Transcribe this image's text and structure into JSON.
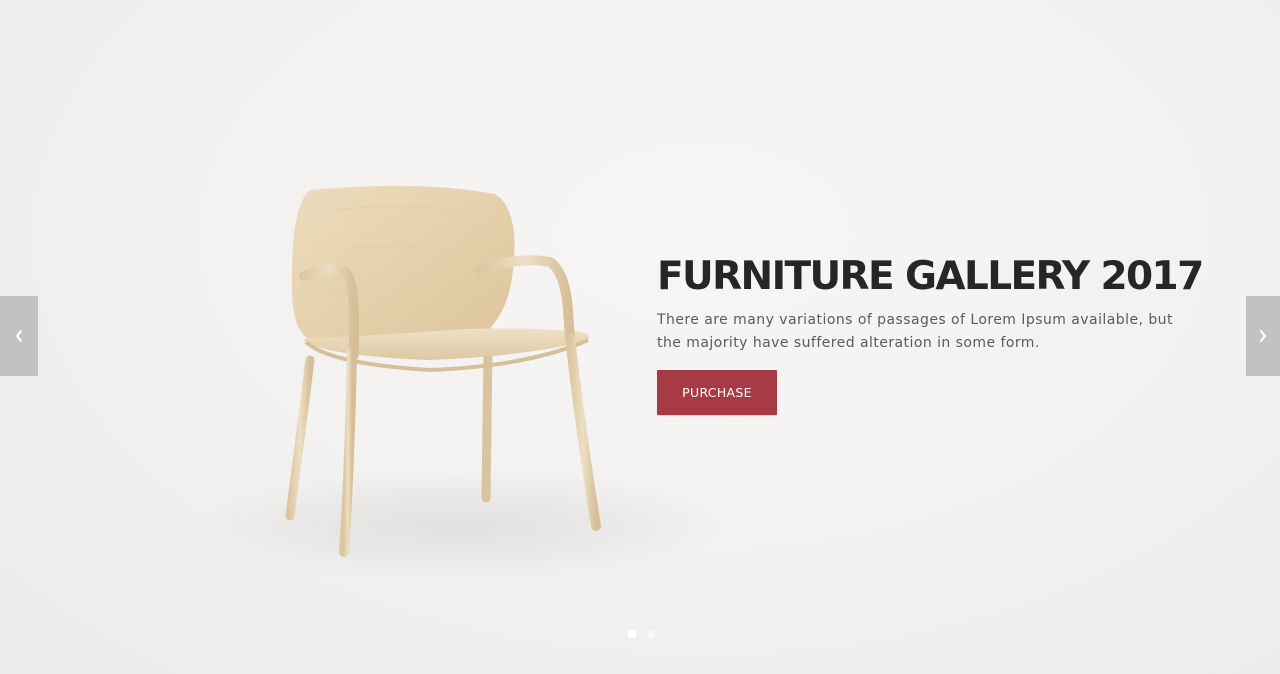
{
  "slider": {
    "title": "FURNITURE GALLERY 2017",
    "description": "There are many variations of passages of Lorem Ipsum available, but the majority have suffered alteration in some form.",
    "button_label": "PURCHASE",
    "prev_icon": "chevron-left-icon",
    "next_icon": "chevron-right-icon",
    "dots_total": 2,
    "active_dot": 1
  },
  "colors": {
    "background": "#f2f1ef",
    "title": "#262626",
    "text": "#5b5b5b",
    "button": "#a83a45",
    "nav_arrow_bg": "#c2c2c1",
    "chair_wood": "#e6d3b0"
  }
}
